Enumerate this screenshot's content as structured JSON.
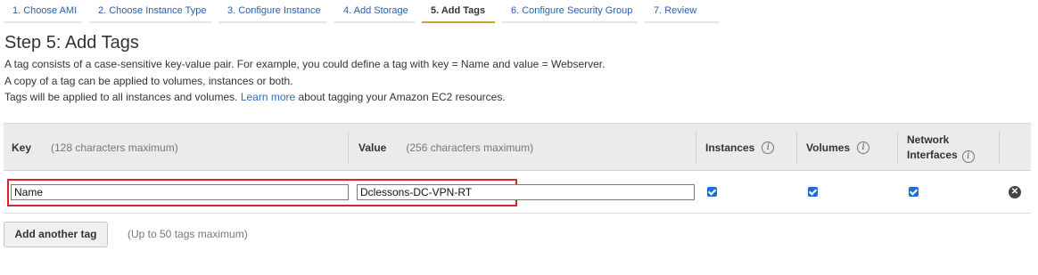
{
  "wizard_steps": [
    {
      "label": "1. Choose AMI"
    },
    {
      "label": "2. Choose Instance Type"
    },
    {
      "label": "3. Configure Instance"
    },
    {
      "label": "4. Add Storage"
    },
    {
      "label": "5. Add Tags"
    },
    {
      "label": "6. Configure Security Group"
    },
    {
      "label": "7. Review"
    }
  ],
  "page": {
    "title": "Step 5: Add Tags",
    "line1": "A tag consists of a case-sensitive key-value pair. For example, you could define a tag with key = Name and value = Webserver.",
    "line2": "A copy of a tag can be applied to volumes, instances or both.",
    "line3_prefix": "Tags will be applied to all instances and volumes.",
    "learn_more": "Learn more",
    "line3_suffix": "about tagging your Amazon EC2 resources."
  },
  "table": {
    "headers": {
      "key": "Key",
      "key_hint": "(128 characters maximum)",
      "value": "Value",
      "value_hint": "(256 characters maximum)",
      "instances": "Instances",
      "volumes": "Volumes",
      "network_line1": "Network",
      "network_line2": "Interfaces",
      "info_glyph": "i"
    },
    "rows": [
      {
        "key": "Name",
        "value": "Dclessons-DC-VPN-RT",
        "instances": true,
        "volumes": true,
        "network_interfaces": true,
        "remove_glyph": "✕"
      }
    ]
  },
  "footer": {
    "add_button": "Add another tag",
    "hint": "(Up to 50 tags maximum)"
  },
  "colors": {
    "link": "#2a6ec0",
    "active_step_underline": "#c9a227",
    "checkbox": "#1b6fd6",
    "highlight_box": "#e0202a"
  }
}
